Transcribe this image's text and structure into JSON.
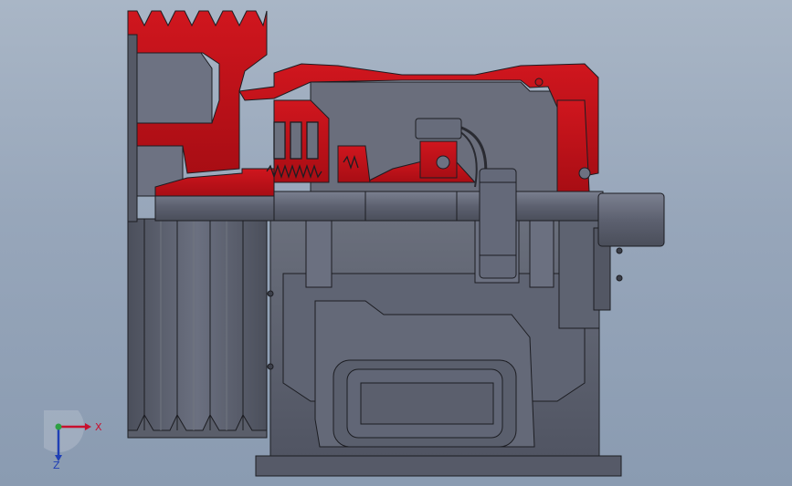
{
  "viewport": {
    "background_top": "#a9b6c6",
    "background_bottom": "#8a9bb1",
    "section_color": "#c0121a",
    "body_color": "#5c6170",
    "edge_color": "#1c1d22"
  },
  "triad": {
    "x_label": "X",
    "z_label": "Z",
    "x_color": "#c8102e",
    "y_color": "#2ea043",
    "z_color": "#1f3fb5"
  }
}
